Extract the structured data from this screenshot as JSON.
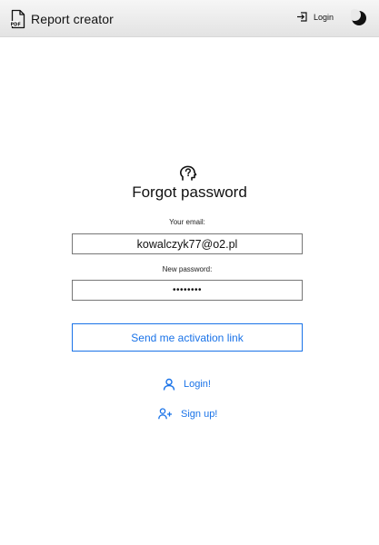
{
  "header": {
    "app_title": "Report creator",
    "brand_icon": "pdf-file-icon",
    "login_label": "Login",
    "login_icon": "login-icon",
    "theme_icon": "moon-icon"
  },
  "main": {
    "title": "Forgot password",
    "title_icon": "help-head-icon",
    "email_label": "Your email:",
    "email_value": "kowalczyk77@o2.pl",
    "password_label": "New password:",
    "password_value": "••••••••",
    "send_button_label": "Send me activation link",
    "login_link_label": "Login!",
    "signup_link_label": "Sign up!"
  },
  "colors": {
    "accent": "#1a73e8",
    "text": "#111111",
    "header_bg": "#ececec"
  }
}
